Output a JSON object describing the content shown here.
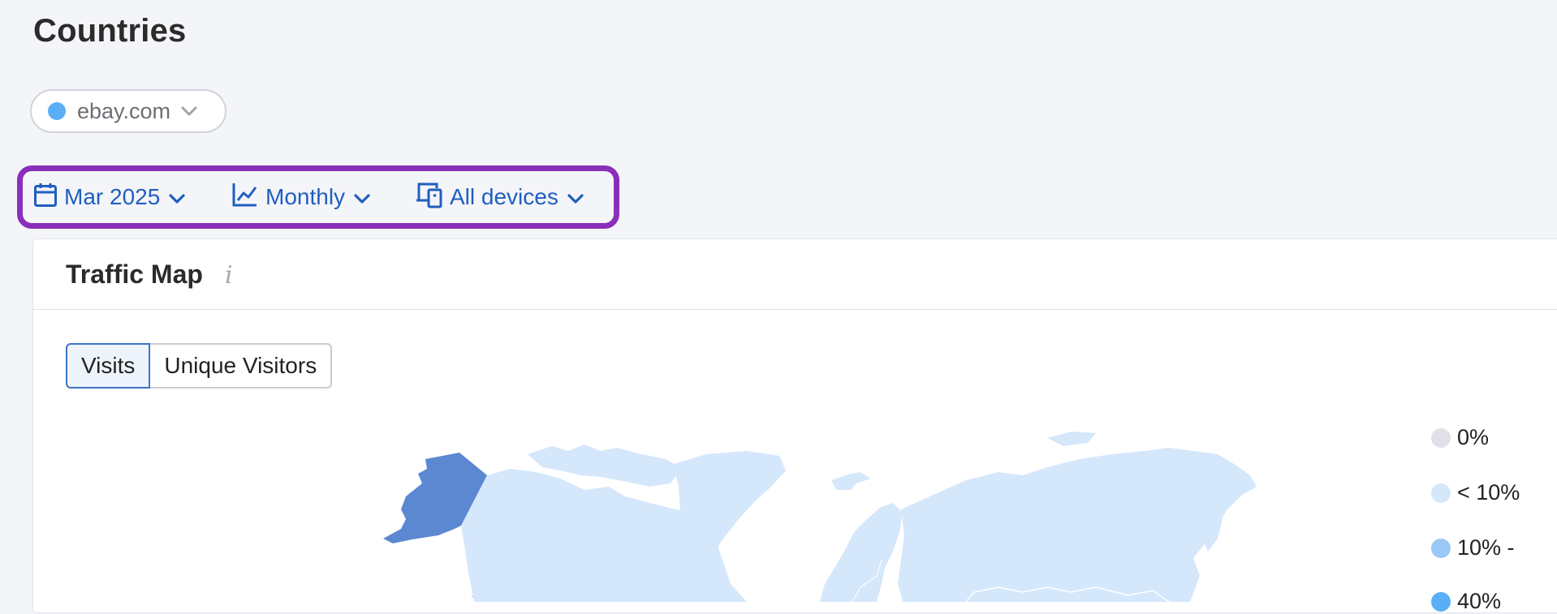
{
  "page": {
    "title": "Countries"
  },
  "domain_selector": {
    "label": "ebay.com",
    "dot_color": "#5aaef6"
  },
  "filters": {
    "date": {
      "label": "Mar 2025",
      "icon": "calendar-icon"
    },
    "granularity": {
      "label": "Monthly",
      "icon": "line-chart-icon"
    },
    "devices": {
      "label": "All devices",
      "icon": "devices-icon"
    }
  },
  "traffic_map": {
    "title": "Traffic Map",
    "info_glyph": "i",
    "tabs": [
      {
        "label": "Visits",
        "active": true
      },
      {
        "label": "Unique Visitors",
        "active": false
      }
    ],
    "legend": [
      {
        "label": "0%",
        "color": "#e0e1e6"
      },
      {
        "label": "< 10%",
        "color": "#d5e7fb"
      },
      {
        "label": "10% -",
        "color": "#9ac7f5"
      },
      {
        "label": "40%",
        "color": "#5aaef6"
      }
    ],
    "colors": {
      "high": "#5b88d1",
      "low": "#d5e7fb"
    }
  }
}
